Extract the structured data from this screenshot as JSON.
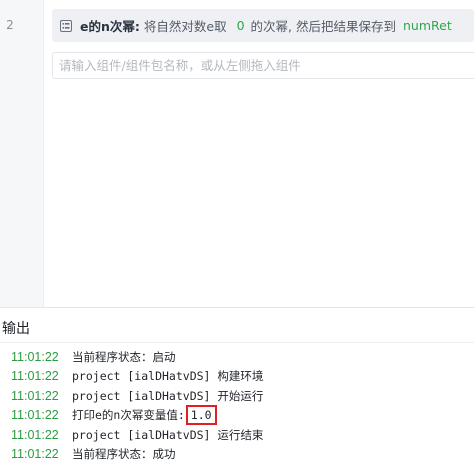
{
  "editor": {
    "line_number": "2",
    "block": {
      "icon": "block-list-icon",
      "title": "e的n次幂:",
      "text1": "将自然对数e取",
      "value1": "0",
      "text2": "的次幂, 然后把结果保存到",
      "value2": "numRet"
    },
    "search_placeholder": "请输入组件/组件包名称，或从左侧拖入组件"
  },
  "output": {
    "title": "输出",
    "logs": [
      {
        "time": "11:01:22",
        "message": "当前程序状态：启动"
      },
      {
        "time": "11:01:22",
        "message": "project [ialDHatvDS] 构建环境"
      },
      {
        "time": "11:01:22",
        "message": "project [ialDHatvDS] 开始运行"
      },
      {
        "time": "11:01:22",
        "message": "打印e的n次幂变量值:",
        "value": "1.0"
      },
      {
        "time": "11:01:22",
        "message": "project [ialDHatvDS] 运行结束"
      },
      {
        "time": "11:01:22",
        "message": "当前程序状态：成功"
      }
    ]
  },
  "colors": {
    "timestamp": "#2a9d3e",
    "block_value": "#2ea84a",
    "highlight_border": "#e02020"
  }
}
